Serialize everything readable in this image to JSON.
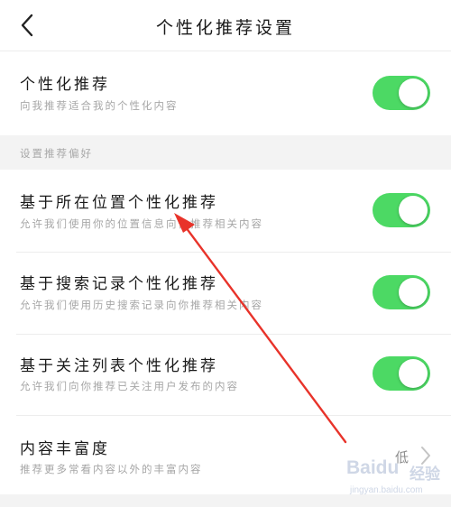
{
  "header": {
    "title": "个性化推荐设置",
    "back_icon": "chevron-left-icon"
  },
  "personal": {
    "title": "个性化推荐",
    "subtitle": "向我推荐适合我的个性化内容",
    "enabled": true
  },
  "section_label": "设置推荐偏好",
  "preferences": [
    {
      "title": "基于所在位置个性化推荐",
      "subtitle": "允许我们使用你的位置信息向你推荐相关内容",
      "enabled": true
    },
    {
      "title": "基于搜索记录个性化推荐",
      "subtitle": "允许我们使用历史搜索记录向你推荐相关内容",
      "enabled": true
    },
    {
      "title": "基于关注列表个性化推荐",
      "subtitle": "允许我们向你推荐已关注用户发布的内容",
      "enabled": true
    }
  ],
  "richness": {
    "title": "内容丰富度",
    "subtitle": "推荐更多常看内容以外的丰富内容",
    "value": "低"
  },
  "colors": {
    "toggle_on": "#4cd964",
    "annotation_arrow": "#e8332a"
  },
  "watermark": {
    "brand": "Baidu",
    "brand_cn": "经验",
    "url": "jingyan.baidu.com"
  }
}
